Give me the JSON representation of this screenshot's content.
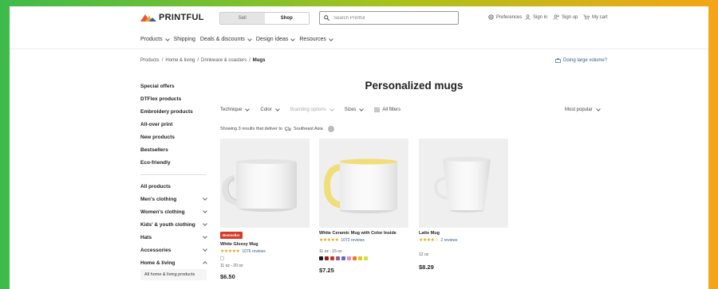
{
  "header": {
    "logo": "PRINTFUL",
    "toggle": {
      "sell": "Sell",
      "shop": "Shop"
    },
    "search_placeholder": "Search Printful",
    "utilities": {
      "preferences": "Preferences",
      "sign_in": "Sign in",
      "sign_up": "Sign up",
      "cart": "My cart"
    }
  },
  "nav": {
    "items": [
      {
        "label": "Products",
        "has_menu": true
      },
      {
        "label": "Shipping",
        "has_menu": false
      },
      {
        "label": "Deals & discounts",
        "has_menu": true
      },
      {
        "label": "Design ideas",
        "has_menu": true
      },
      {
        "label": "Resources",
        "has_menu": true
      }
    ]
  },
  "breadcrumb": {
    "items": [
      "Products",
      "Home & living",
      "Drinkware & coasters"
    ],
    "current": "Mugs"
  },
  "large_volume": "Doing large volume?",
  "sidebar": {
    "top": [
      "Special offers",
      "DTFlex products",
      "Embroidery products",
      "All-over print",
      "New products",
      "Bestsellers",
      "Eco-friendly"
    ],
    "categories": [
      {
        "label": "All products"
      },
      {
        "label": "Men's clothing"
      },
      {
        "label": "Women's clothing"
      },
      {
        "label": "Kids' & youth clothing"
      },
      {
        "label": "Hats"
      },
      {
        "label": "Accessories"
      },
      {
        "label": "Home & living"
      }
    ],
    "sub": "All home & living products"
  },
  "main": {
    "title": "Personalized mugs",
    "filters": [
      "Technique",
      "Color",
      "Branding options",
      "Sizes"
    ],
    "all_filters": "All filters",
    "sort": "Most popular",
    "showing_prefix": "Showing 3 results that deliver to",
    "region": "Southeast Asia"
  },
  "products": [
    {
      "name": "White Glossy Mug",
      "stars": "★★★★★",
      "reviews": "1076 reviews",
      "sizes": "11 oz - 20 oz",
      "price": "$6.50",
      "badge": "Bestseller"
    },
    {
      "name": "White Ceramic Mug with Color Inside",
      "stars": "★★★★★",
      "reviews": "1072 reviews",
      "sizes": "11 oz - 15 oz",
      "price": "$7.25"
    },
    {
      "name": "Latte Mug",
      "stars": "★★★★☆",
      "reviews": "2 reviews",
      "sizes": "12 oz",
      "price": "$8.29"
    }
  ],
  "colors": {
    "accent_yellow": "#f1de7a",
    "badge_red": "#d83b2a",
    "link_blue": "#3a5a8c",
    "star": "#e8a317"
  },
  "swatch_colors": [
    "#1a1a1a",
    "#8b1e2c",
    "#c0392b",
    "#9b5a8f",
    "#5b6ec7",
    "#f08aa8",
    "#e67e22",
    "#f1c40f",
    "#c9e04a"
  ]
}
